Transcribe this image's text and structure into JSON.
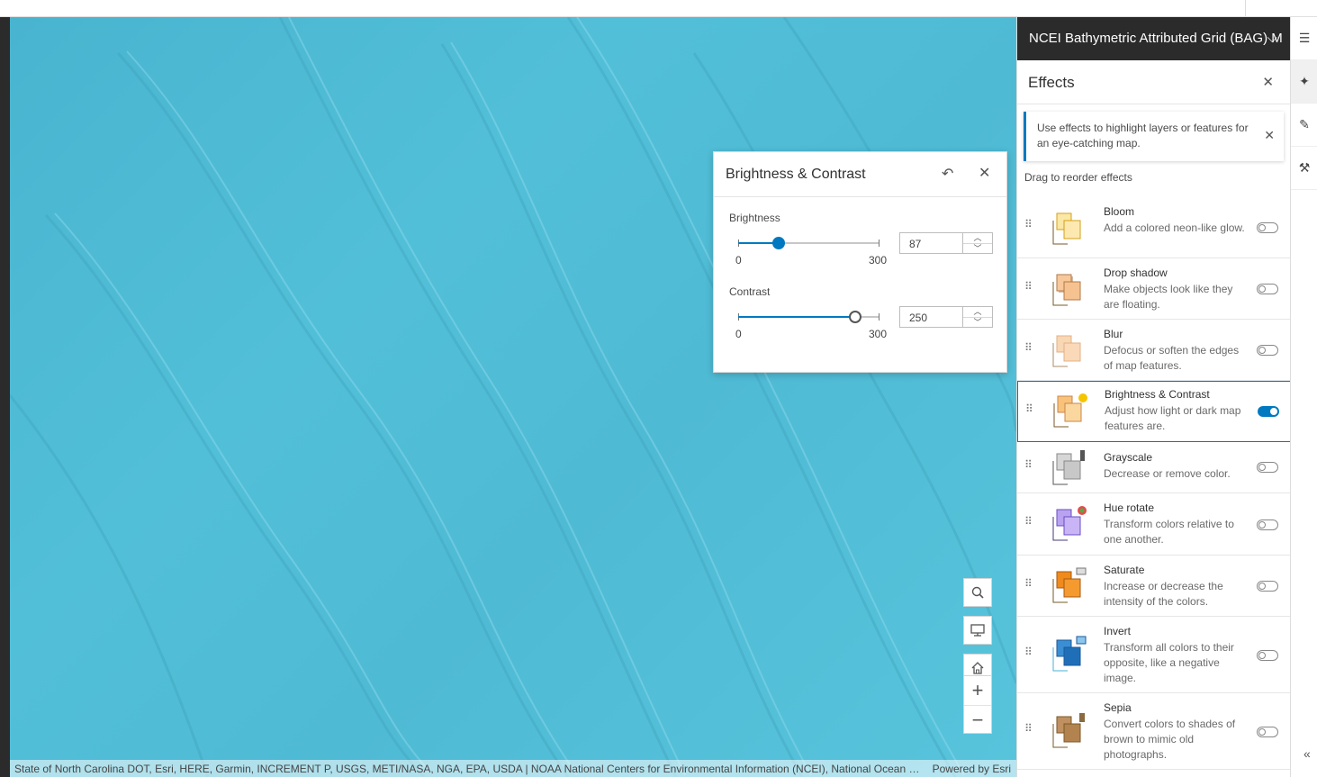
{
  "layer": {
    "title": "NCEI Bathymetric Attributed Grid (BAG) M"
  },
  "effects_panel": {
    "title": "Effects",
    "notice": "Use effects to highlight layers or features for an eye-catching map.",
    "drag_hint": "Drag to reorder effects",
    "items": [
      {
        "name": "Bloom",
        "desc": "Add a colored neon-like glow.",
        "enabled": false
      },
      {
        "name": "Drop shadow",
        "desc": "Make objects look like they are floating.",
        "enabled": false
      },
      {
        "name": "Blur",
        "desc": "Defocus or soften the edges of map features.",
        "enabled": false
      },
      {
        "name": "Brightness & Contrast",
        "desc": "Adjust how light or dark map features are.",
        "enabled": true
      },
      {
        "name": "Grayscale",
        "desc": "Decrease or remove color.",
        "enabled": false
      },
      {
        "name": "Hue rotate",
        "desc": "Transform colors relative to one another.",
        "enabled": false
      },
      {
        "name": "Saturate",
        "desc": "Increase or decrease the intensity of the colors.",
        "enabled": false
      },
      {
        "name": "Invert",
        "desc": "Transform all colors to their opposite, like a negative image.",
        "enabled": false
      },
      {
        "name": "Sepia",
        "desc": "Convert colors to shades of brown to mimic old photographs.",
        "enabled": false
      }
    ]
  },
  "bc_panel": {
    "title": "Brightness & Contrast",
    "brightness": {
      "label": "Brightness",
      "value": "87",
      "min": "0",
      "max": "300"
    },
    "contrast": {
      "label": "Contrast",
      "value": "250",
      "min": "0",
      "max": "300"
    }
  },
  "map": {
    "attribution": "State of North Carolina DOT, Esri, HERE, Garmin, INCREMENT P, USGS, METI/NASA, NGA, EPA, USDA | NOAA National Centers for Environmental Information (NCEI), National Ocean Ser...",
    "powered_by": "Powered by Esri",
    "buttons": [
      "search-icon",
      "screen-icon",
      "home-icon",
      "plus-icon",
      "minus-icon"
    ]
  },
  "colors": {
    "accent": "#0079c1",
    "water": "#52bfd8",
    "header_bg": "#2b2b2b"
  }
}
